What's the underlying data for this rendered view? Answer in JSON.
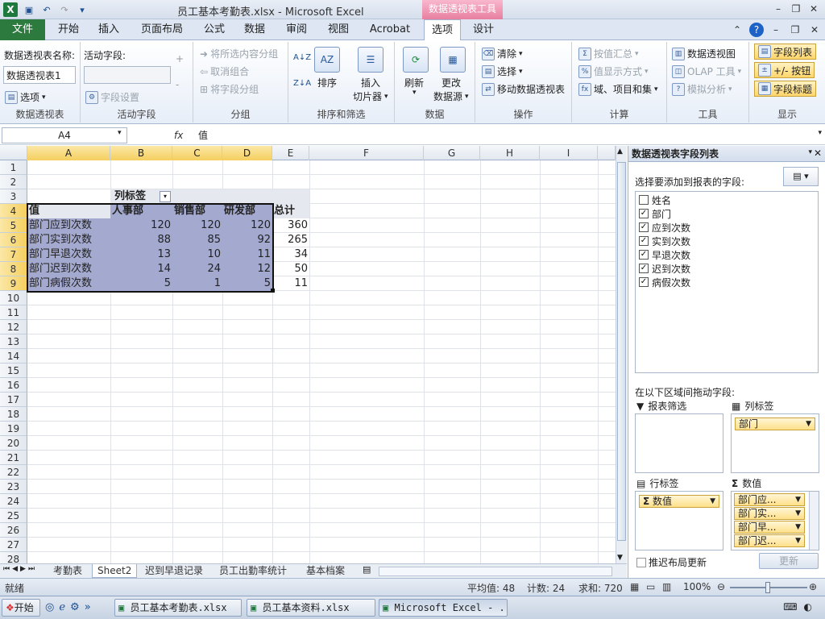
{
  "window": {
    "title": "员工基本考勤表.xlsx - Microsoft Excel",
    "context_tools": "数据透视表工具"
  },
  "ribbon_tabs": [
    {
      "label": "文件"
    },
    {
      "label": "开始"
    },
    {
      "label": "插入"
    },
    {
      "label": "页面布局"
    },
    {
      "label": "公式"
    },
    {
      "label": "数据"
    },
    {
      "label": "审阅"
    },
    {
      "label": "视图"
    },
    {
      "label": "Acrobat"
    },
    {
      "label": "选项",
      "active": true
    },
    {
      "label": "设计"
    }
  ],
  "ribbon": {
    "pivot": {
      "name_label": "数据透视表名称:",
      "name_value": "数据透视表1",
      "options_btn": "选项",
      "group": "数据透视表"
    },
    "active_field": {
      "label": "活动字段:",
      "settings_btn": "字段设置",
      "group": "活动字段"
    },
    "grouping": {
      "group_selection": "将所选内容分组",
      "ungroup": "取消组合",
      "group_field": "将字段分组",
      "group": "分组"
    },
    "sort_filter": {
      "sort": "排序",
      "insert_slicer": "插入",
      "insert_slicer2": "切片器",
      "group": "排序和筛选"
    },
    "data": {
      "refresh": "刷新",
      "change_source": "更改",
      "change_source2": "数据源",
      "group": "数据"
    },
    "actions": {
      "clear": "清除",
      "select": "选择",
      "move": "移动数据透视表",
      "group": "操作"
    },
    "calc": {
      "summarize": "按值汇总",
      "show_as": "值显示方式",
      "fields_items": "域、项目和集",
      "group": "计算"
    },
    "tools": {
      "pivot_chart": "数据透视图",
      "olap": "OLAP 工具",
      "whatif": "模拟分析",
      "group": "工具"
    },
    "show": {
      "field_list": "字段列表",
      "buttons": "+/- 按钮",
      "headers": "字段标题",
      "group": "显示"
    }
  },
  "formula_bar": {
    "name_box": "A4",
    "fx": "fx",
    "value": "值"
  },
  "columns": [
    "A",
    "B",
    "C",
    "D",
    "E",
    "F",
    "G",
    "H",
    "I"
  ],
  "rows": [
    "1",
    "2",
    "3",
    "4",
    "5",
    "6",
    "7",
    "8",
    "9",
    "10",
    "11",
    "12",
    "13",
    "14",
    "15",
    "16",
    "17",
    "18",
    "19",
    "20",
    "21",
    "22",
    "23",
    "24",
    "25",
    "26",
    "27",
    "28"
  ],
  "pivot": {
    "col_label": "列标签",
    "corner": "值",
    "headers": [
      "人事部",
      "销售部",
      "研发部",
      "总计"
    ],
    "rows": [
      {
        "label": "部门应到次数",
        "values": [
          "120",
          "120",
          "120",
          "360"
        ]
      },
      {
        "label": "部门实到次数",
        "values": [
          "88",
          "85",
          "92",
          "265"
        ]
      },
      {
        "label": "部门早退次数",
        "values": [
          "13",
          "10",
          "11",
          "34"
        ]
      },
      {
        "label": "部门迟到次数",
        "values": [
          "14",
          "24",
          "12",
          "50"
        ]
      },
      {
        "label": "部门病假次数",
        "values": [
          "5",
          "1",
          "5",
          "11"
        ]
      }
    ]
  },
  "sheets": [
    {
      "label": "考勤表"
    },
    {
      "label": "Sheet2",
      "active": true
    },
    {
      "label": "迟到早退记录"
    },
    {
      "label": "员工出勤率统计"
    },
    {
      "label": "基本档案"
    }
  ],
  "status": {
    "ready": "就绪",
    "average": "平均值: 48",
    "count": "计数: 24",
    "sum": "求和: 720",
    "zoom": "100%"
  },
  "taskbar": {
    "start": "开始",
    "items": [
      "员工基本考勤表.xlsx",
      "员工基本资料.xlsx",
      "Microsoft Excel - ..."
    ]
  },
  "field_panel": {
    "title": "数据透视表字段列表",
    "choose_label": "选择要添加到报表的字段:",
    "fields": [
      {
        "label": "姓名",
        "checked": false
      },
      {
        "label": "部门",
        "checked": true
      },
      {
        "label": "应到次数",
        "checked": true
      },
      {
        "label": "实到次数",
        "checked": true
      },
      {
        "label": "早退次数",
        "checked": true
      },
      {
        "label": "迟到次数",
        "checked": true
      },
      {
        "label": "病假次数",
        "checked": true
      }
    ],
    "drag_label": "在以下区域间拖动字段:",
    "report_filter": "报表筛选",
    "column_labels": "列标签",
    "row_labels": "行标签",
    "values": "数值",
    "column_field": "部门",
    "row_field": "数值",
    "value_fields": [
      "部门应...",
      "部门实...",
      "部门早...",
      "部门迟..."
    ],
    "defer_update": "推迟布局更新",
    "update_btn": "更新"
  }
}
